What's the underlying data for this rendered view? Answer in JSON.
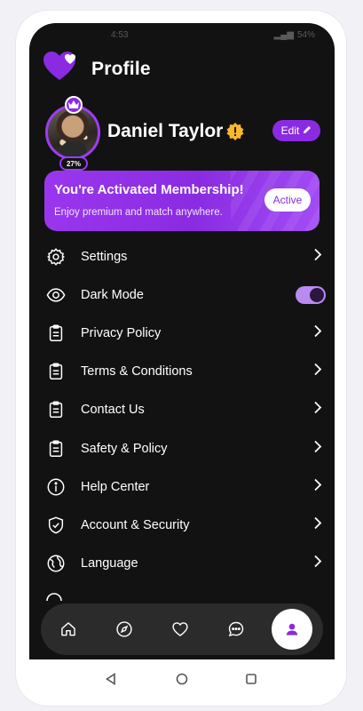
{
  "status_bar": {
    "time": "4:53",
    "battery": "54%"
  },
  "header": {
    "title": "Profile"
  },
  "profile": {
    "name": "Daniel Taylor",
    "completion": "27%",
    "edit_label": "Edit"
  },
  "membership": {
    "title": "You're Activated Membership!",
    "subtitle": "Enjoy  premium and match anywhere.",
    "status_label": "Active"
  },
  "menu": {
    "items": [
      {
        "label": "Settings",
        "icon": "gear-icon"
      },
      {
        "label": "Dark Mode",
        "icon": "eye-icon",
        "toggle_on": true
      },
      {
        "label": "Privacy Policy",
        "icon": "clipboard-icon"
      },
      {
        "label": "Terms & Conditions",
        "icon": "clipboard-icon"
      },
      {
        "label": "Contact Us",
        "icon": "clipboard-icon"
      },
      {
        "label": "Safety & Policy",
        "icon": "clipboard-icon"
      },
      {
        "label": "Help Center",
        "icon": "info-icon"
      },
      {
        "label": "Account & Security",
        "icon": "shield-check-icon"
      },
      {
        "label": "Language",
        "icon": "globe-icon"
      }
    ]
  },
  "bottom_nav": {
    "items": [
      "home-icon",
      "compass-icon",
      "heart-icon",
      "chat-icon",
      "profile-icon"
    ],
    "active": "profile-icon"
  },
  "colors": {
    "accent": "#8a2be2",
    "background": "#121212",
    "nav_background": "#2b2b2b",
    "verified": "#f5b82e"
  }
}
